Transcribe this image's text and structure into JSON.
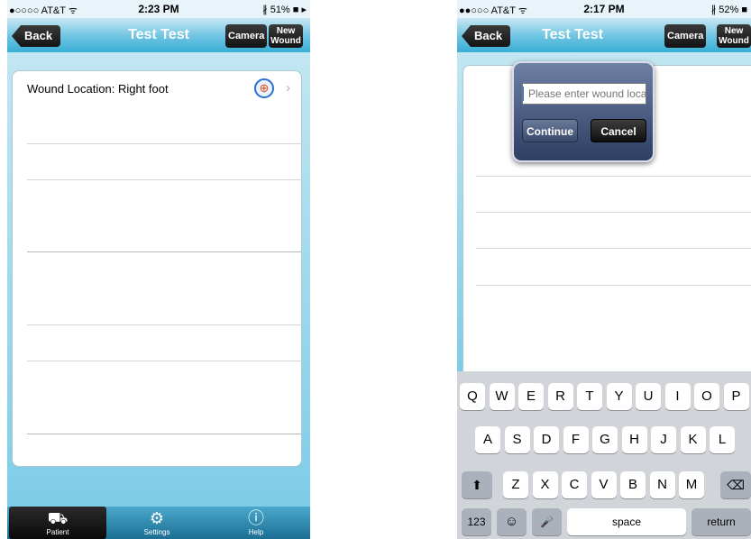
{
  "left_screen": {
    "status": {
      "carrier": "●○○○○ AT&T ᯤ",
      "time": "2:23 PM",
      "battery": "∦ 51% ■ ▸"
    },
    "nav": {
      "back": "Back",
      "title": "Test Test",
      "camera": "Camera",
      "new_wound": "New\nWound"
    },
    "wound_row": {
      "label": "Wound Location: Right foot",
      "icon": "foot-add-icon"
    },
    "tabs": [
      {
        "label": "Patient",
        "icon": "patient-bed-icon",
        "glyph": "⛟",
        "active": true
      },
      {
        "label": "Settings",
        "icon": "gear-icon",
        "glyph": "⚙",
        "active": false
      },
      {
        "label": "Help",
        "icon": "info-icon",
        "glyph": "ⓘ",
        "active": false
      }
    ]
  },
  "right_screen": {
    "status": {
      "carrier": "●●○○○ AT&T ᯤ",
      "time": "2:17 PM",
      "battery": "∦ 52% ■"
    },
    "nav": {
      "back": "Back",
      "title": "Test Test",
      "camera": "Camera",
      "new_wound": "New\nWound"
    },
    "dialog": {
      "placeholder": "Please enter wound location",
      "continue": "Continue",
      "cancel": "Cancel"
    },
    "keyboard": {
      "row1": [
        "Q",
        "W",
        "E",
        "R",
        "T",
        "Y",
        "U",
        "I",
        "O",
        "P"
      ],
      "row2": [
        "A",
        "S",
        "D",
        "F",
        "G",
        "H",
        "J",
        "K",
        "L"
      ],
      "row3": [
        "Z",
        "X",
        "C",
        "V",
        "B",
        "N",
        "M"
      ],
      "shift": "⬆",
      "delete": "⌫",
      "numbers": "123",
      "emoji": "☺",
      "mic": "🎤",
      "space": "space",
      "return": "return"
    }
  }
}
